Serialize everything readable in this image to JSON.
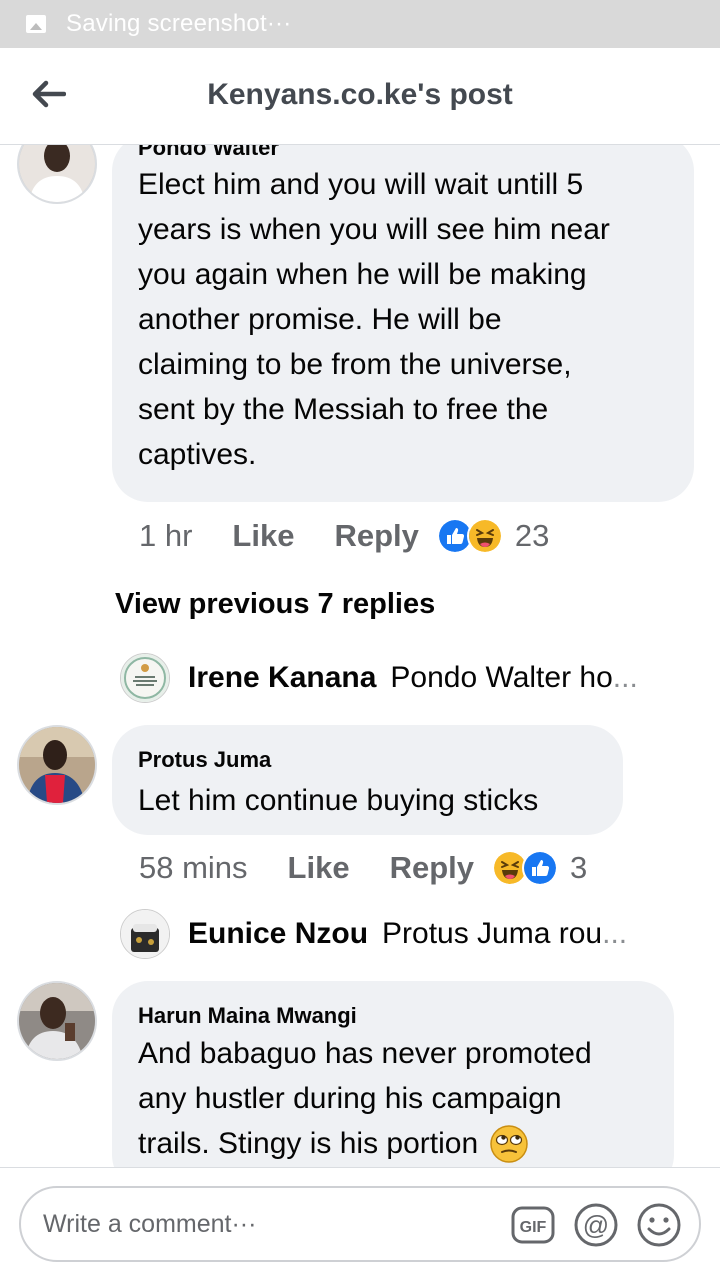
{
  "status_bar": {
    "text": "Saving screenshot···",
    "icon": "image-icon"
  },
  "header": {
    "title": "Kenyans.co.ke's post",
    "back_icon": "back-arrow-icon"
  },
  "comments": [
    {
      "name": "Pondo Walter",
      "lines": [
        "Elect him and you will wait untill 5",
        "years is when you will see him near",
        "you again when he will be making",
        "another promise. He will be",
        "claiming to be from the universe,",
        "sent by the Messiah to free the",
        "captives."
      ],
      "time": "1 hr",
      "like": "Like",
      "reply": "Reply",
      "reactions": [
        "like",
        "haha"
      ],
      "reaction_count": "23"
    },
    {
      "name": "Protus Juma",
      "lines": [
        "Let him continue buying sticks"
      ],
      "time": "58 mins",
      "like": "Like",
      "reply": "Reply",
      "reactions": [
        "haha",
        "like"
      ],
      "reaction_count": "3"
    },
    {
      "name": "Harun Maina Mwangi",
      "lines": [
        "And babaguo has never promoted",
        "any hustler during his campaign",
        "trails. Stingy is his portion"
      ],
      "emoji": "rolling-eyes-emoji"
    }
  ],
  "view_previous": "View previous 7 replies",
  "replies": [
    {
      "name": "Irene Kanana",
      "text": "Pondo Walter ho",
      "ellipsis": "..."
    },
    {
      "name": "Eunice Nzou",
      "text": "Protus Juma rou",
      "ellipsis": "..."
    }
  ],
  "composer": {
    "placeholder": "Write a comment···",
    "gif_label": "GIF",
    "mention_label": "@"
  },
  "colors": {
    "like_blue": "#1877f2",
    "haha_yellow": "#f7b928",
    "bubble": "#eff1f4"
  }
}
